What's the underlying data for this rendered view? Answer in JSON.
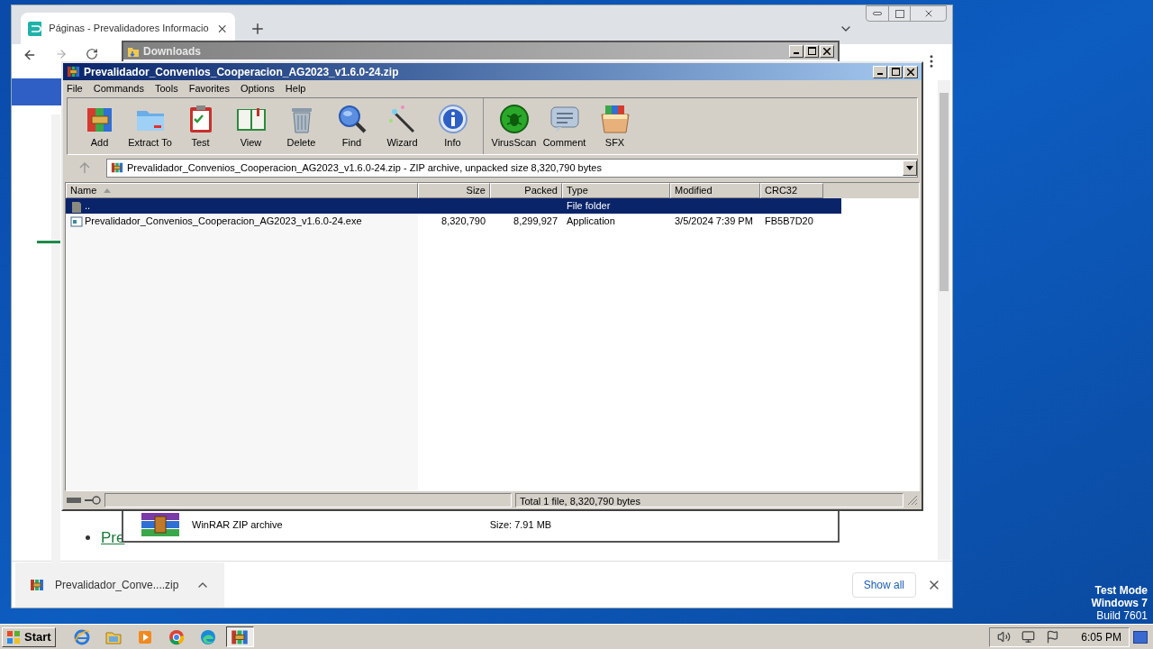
{
  "browser": {
    "tab_title": "Páginas - Prevalidadores Informacio",
    "page_link": "Pre",
    "download_bar": {
      "file": "Prevalidador_Conve....zip",
      "show_all": "Show all"
    }
  },
  "explorer": {
    "title": "Downloads",
    "file_type": "WinRAR ZIP archive",
    "file_size": "Size: 7.91 MB"
  },
  "winrar": {
    "title": "Prevalidador_Convenios_Cooperacion_AG2023_v1.6.0-24.zip",
    "menu": [
      "File",
      "Commands",
      "Tools",
      "Favorites",
      "Options",
      "Help"
    ],
    "toolbar_groups": [
      {
        "items": [
          {
            "label": "Add",
            "kind": "add"
          },
          {
            "label": "Extract To",
            "kind": "extract"
          },
          {
            "label": "Test",
            "kind": "test"
          },
          {
            "label": "View",
            "kind": "view"
          },
          {
            "label": "Delete",
            "kind": "delete"
          },
          {
            "label": "Find",
            "kind": "find"
          },
          {
            "label": "Wizard",
            "kind": "wizard"
          },
          {
            "label": "Info",
            "kind": "info"
          }
        ]
      },
      {
        "items": [
          {
            "label": "VirusScan",
            "kind": "virusscan"
          },
          {
            "label": "Comment",
            "kind": "comment"
          },
          {
            "label": "SFX",
            "kind": "sfx"
          }
        ]
      }
    ],
    "address": "Prevalidador_Convenios_Cooperacion_AG2023_v1.6.0-24.zip - ZIP archive, unpacked size 8,320,790 bytes",
    "columns": [
      "Name",
      "Size",
      "Packed",
      "Type",
      "Modified",
      "CRC32"
    ],
    "rows": [
      {
        "kind": "folder",
        "name": "..",
        "type": "File folder",
        "selected": true
      },
      {
        "kind": "exe",
        "name": "Prevalidador_Convenios_Cooperacion_AG2023_v1.6.0-24.exe",
        "size": "8,320,790",
        "packed": "8,299,927",
        "type": "Application",
        "modified": "3/5/2024 7:39 PM",
        "crc32": "FB5B7D20",
        "selected": false
      }
    ],
    "status": "Total 1 file, 8,320,790 bytes"
  },
  "desktop": {
    "lines": [
      "Test Mode",
      "Windows 7",
      "Build 7601"
    ]
  },
  "taskbar": {
    "start": "Start",
    "apps": [
      {
        "kind": "ie",
        "selected": false
      },
      {
        "kind": "explorer",
        "selected": false
      },
      {
        "kind": "media",
        "selected": false
      },
      {
        "kind": "chrome",
        "selected": false
      },
      {
        "kind": "edge",
        "selected": false
      },
      {
        "kind": "winrar",
        "selected": true
      }
    ],
    "clock": "6:05 PM"
  }
}
